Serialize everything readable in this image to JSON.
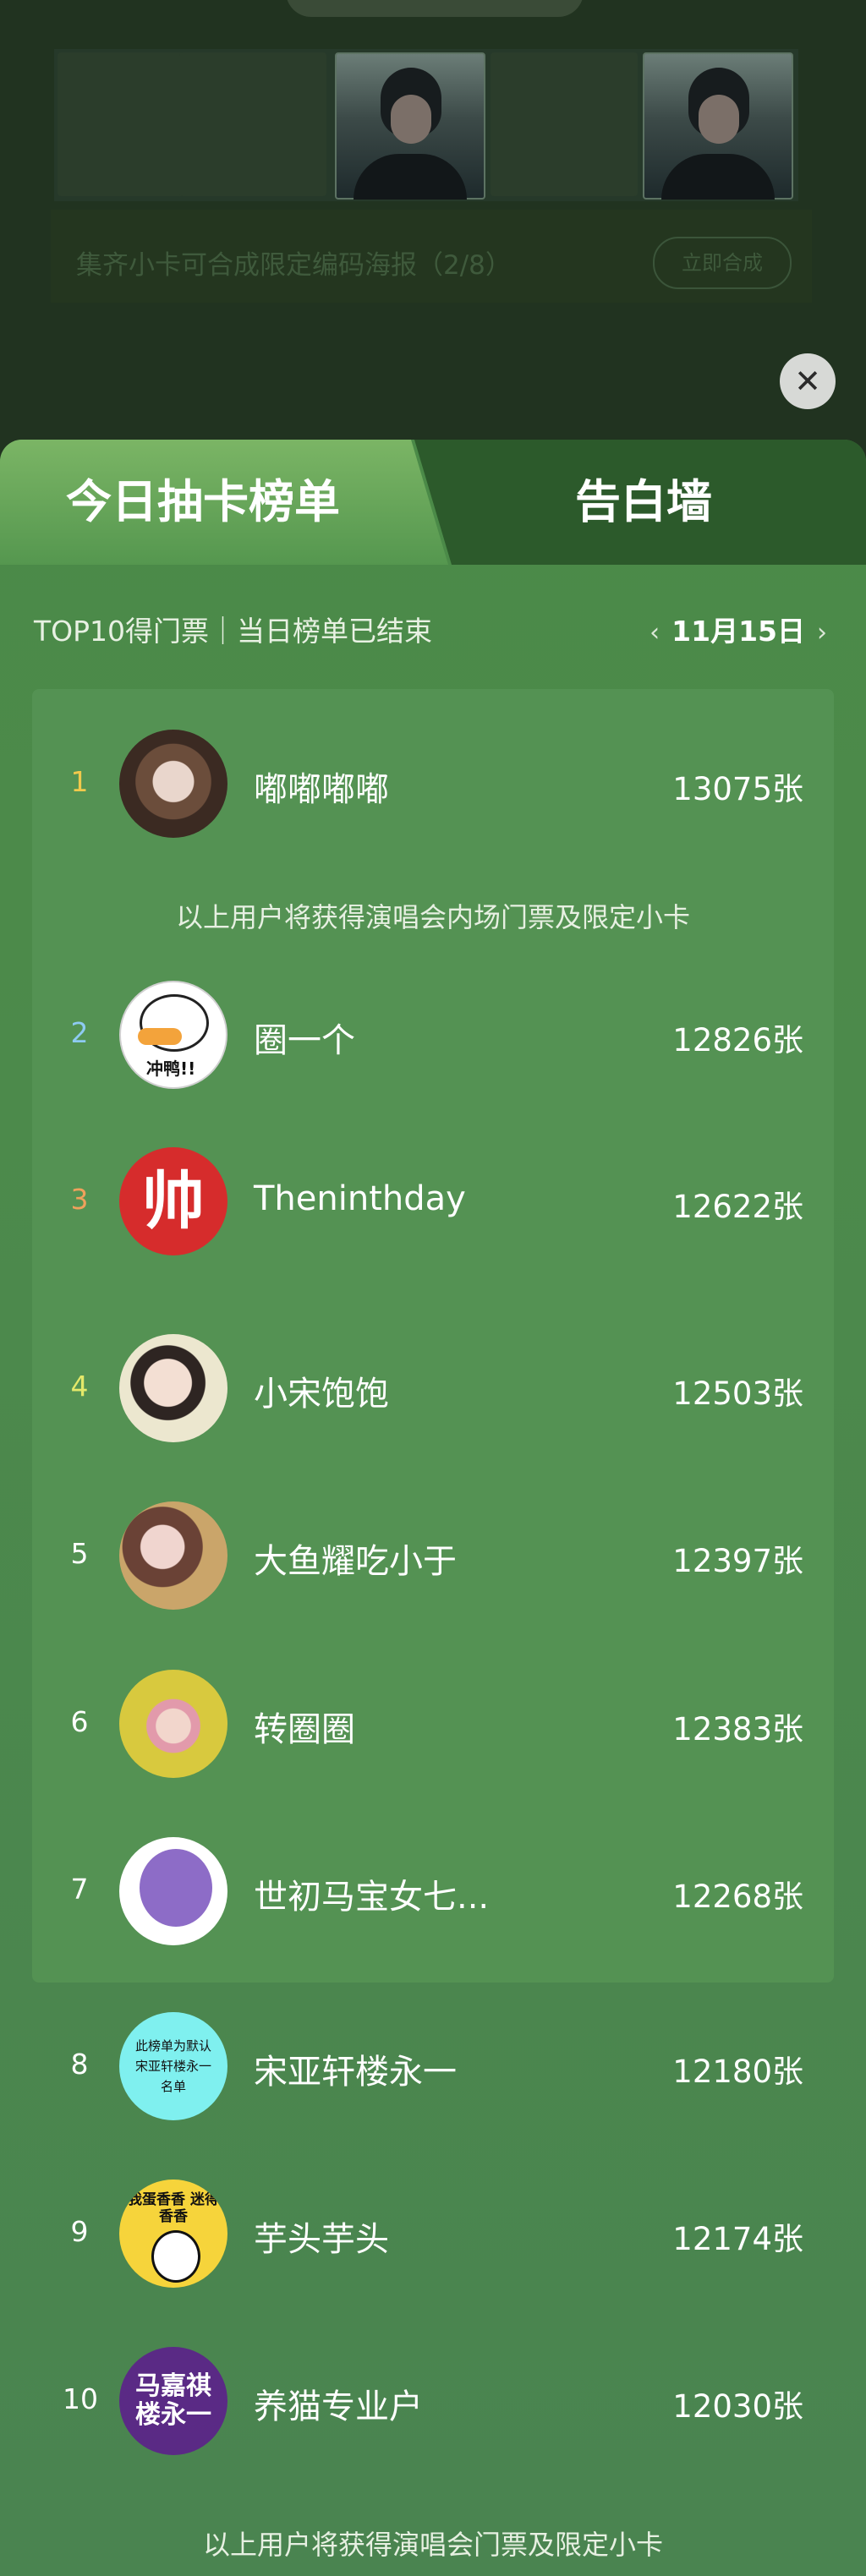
{
  "background": {
    "banner_text": "集齐小卡可合成限定编码海报（2/8）",
    "banner_button": "立即合成"
  },
  "close_label": "✕",
  "tabs": [
    {
      "label": "今日抽卡榜单",
      "active": true
    },
    {
      "label": "告白墙",
      "active": false
    }
  ],
  "info": "TOP10得门票｜当日榜单已结束",
  "date_nav": {
    "prev": "‹",
    "date": "11月15日",
    "next": "›"
  },
  "avatar_text": {
    "r2": "冲鸭!!",
    "r3": "帅",
    "r8": [
      "此榜单为默认",
      "宋亚轩楼永一",
      "名单"
    ],
    "r9": "我蛋香香 迷得香香",
    "r10": [
      "马嘉祺",
      "楼永一"
    ]
  },
  "ranking": [
    {
      "rank": "1",
      "name": "嘟嘟嘟嘟",
      "count": "13075张"
    },
    {
      "rank": "2",
      "name": "圈一个",
      "count": "12826张"
    },
    {
      "rank": "3",
      "name": "Theninthday",
      "count": "12622张"
    },
    {
      "rank": "4",
      "name": "小宋饱饱",
      "count": "12503张"
    },
    {
      "rank": "5",
      "name": "大鱼耀吃小于",
      "count": "12397张"
    },
    {
      "rank": "6",
      "name": "转圈圈",
      "count": "12383张"
    },
    {
      "rank": "7",
      "name": "世初马宝女七...",
      "count": "12268张"
    },
    {
      "rank": "8",
      "name": "宋亚轩楼永一",
      "count": "12180张"
    },
    {
      "rank": "9",
      "name": "芋头芋头",
      "count": "12174张"
    },
    {
      "rank": "10",
      "name": "养猫专业户",
      "count": "12030张"
    }
  ],
  "rank_colors": {
    "1": "#f2c94c",
    "2": "#8ecbf2",
    "3": "#f0a15c",
    "4": "#e4e86a"
  },
  "notes": {
    "top1": "以上用户将获得演唱会内场门票及限定小卡",
    "top10": "以上用户将获得演唱会门票及限定小卡"
  }
}
